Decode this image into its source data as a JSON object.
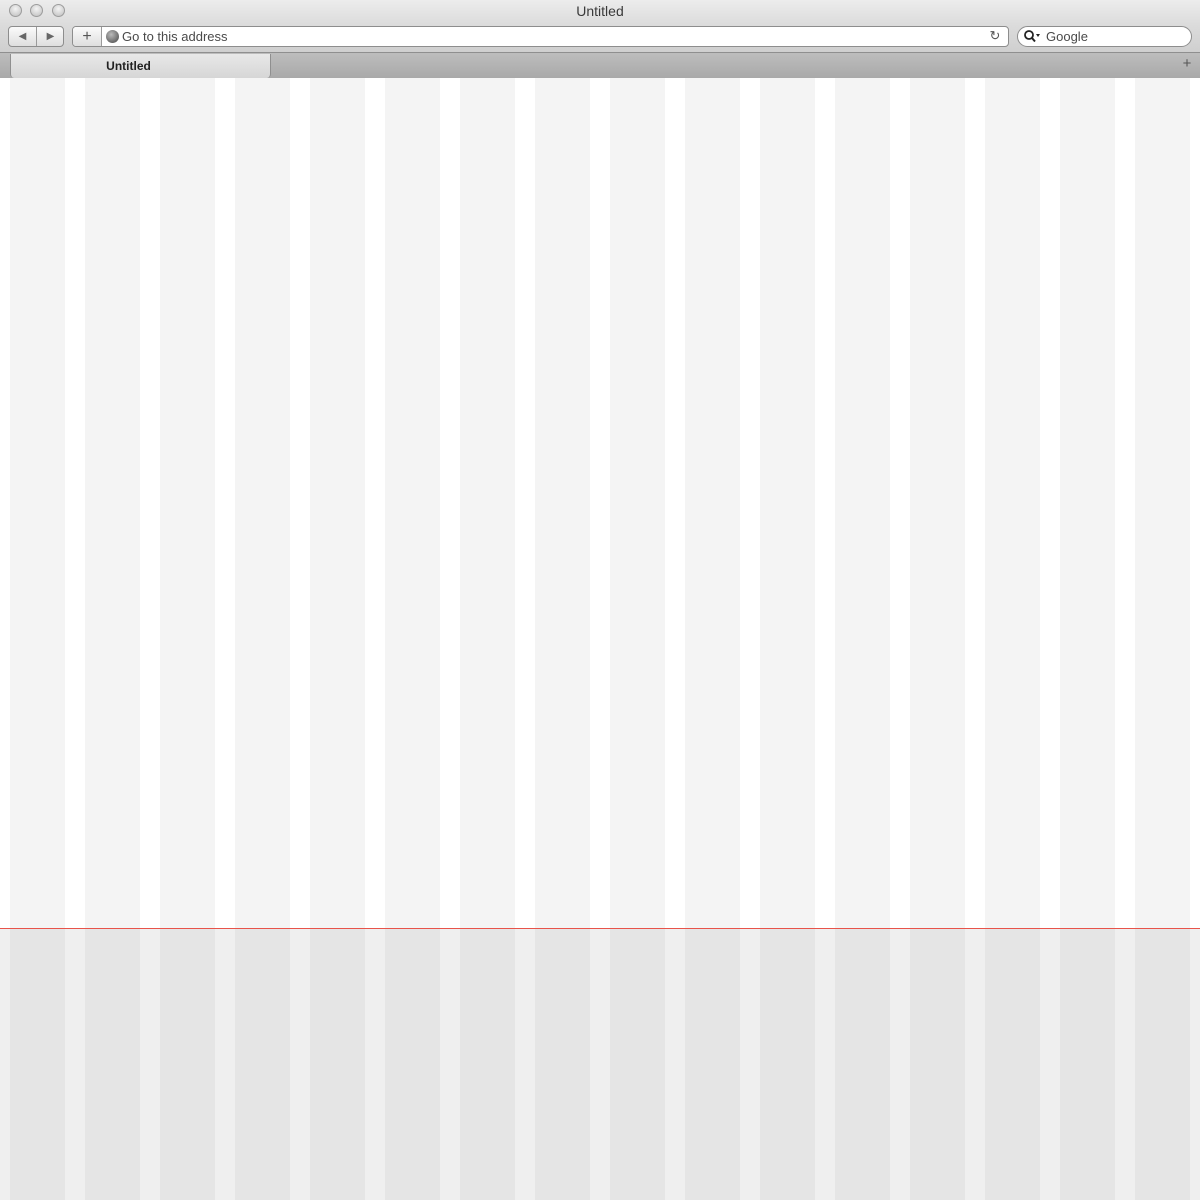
{
  "window": {
    "title": "Untitled",
    "buttons": [
      "close",
      "minimize",
      "zoom"
    ]
  },
  "toolbar": {
    "back_icon": "back-arrow-icon",
    "forward_icon": "forward-arrow-icon",
    "add_bookmark_icon": "plus-icon",
    "address": {
      "placeholder": "Go to this address",
      "icon": "globe-icon",
      "reload_icon": "reload-icon"
    },
    "search": {
      "placeholder": "Google",
      "icon": "magnifier-dropdown-icon"
    }
  },
  "tabs": [
    {
      "label": "Untitled",
      "active": true
    }
  ],
  "tabbar": {
    "new_tab_icon": "plus-icon"
  },
  "content": {
    "column_count": 16,
    "fold_line_color": "#e8534a",
    "column_color": "#f4f4f4",
    "below_fold_column_color": "#e5e5e5"
  }
}
